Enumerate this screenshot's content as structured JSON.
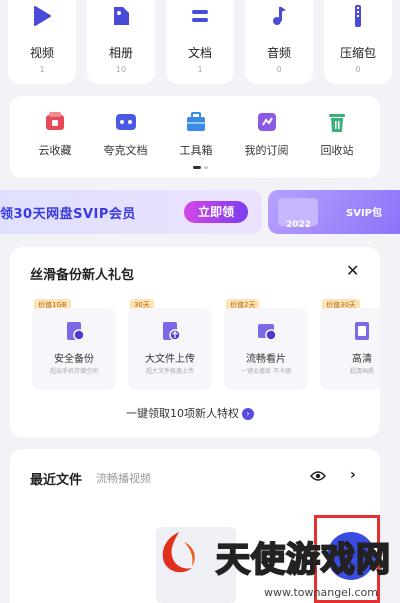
{
  "categories": [
    {
      "label": "视频",
      "count": "1",
      "icon": "play-icon"
    },
    {
      "label": "相册",
      "count": "10",
      "icon": "photo-icon"
    },
    {
      "label": "文档",
      "count": "1",
      "icon": "document-icon"
    },
    {
      "label": "音频",
      "count": "0",
      "icon": "music-icon"
    },
    {
      "label": "压缩包",
      "count": "0",
      "icon": "zip-icon"
    }
  ],
  "tools": [
    {
      "label": "云收藏",
      "icon": "cloud-bookmark-icon",
      "color": "#e64a5a"
    },
    {
      "label": "夸克文档",
      "icon": "quark-doc-icon",
      "color": "#4a5ae6"
    },
    {
      "label": "工具箱",
      "icon": "toolbox-icon",
      "color": "#3a8be6"
    },
    {
      "label": "我的订阅",
      "icon": "subscription-icon",
      "color": "#8a5ae6"
    },
    {
      "label": "回收站",
      "icon": "trash-icon",
      "color": "#3ab07a"
    }
  ],
  "banner": {
    "text": "领30天网盘SVIP会员",
    "button": "立即领",
    "year": "2022",
    "right_text": "SVIP包"
  },
  "gift": {
    "title": "丝滑备份新人礼包",
    "close": "✕",
    "perks": [
      {
        "tag": "价值1GB",
        "label": "安全备份",
        "sub": "超出手机存储空间",
        "icon": "safe-backup-icon"
      },
      {
        "tag": "30天",
        "label": "大文件上传",
        "sub": "超大文件极速上传",
        "icon": "large-upload-icon"
      },
      {
        "tag": "价值2天",
        "label": "流畅看片",
        "sub": "一键云播放 不卡顿",
        "icon": "smooth-video-icon"
      },
      {
        "tag": "价值30天",
        "label": "高清",
        "sub": "超清画质",
        "icon": "hd-icon"
      }
    ],
    "claim": "一键领取10项新人特权"
  },
  "recent": {
    "title": "最近文件",
    "subtitle": "流畅播视频",
    "chevron": "›"
  },
  "watermark": {
    "text": "天使游戏网",
    "url": "www.townangel.com"
  },
  "colors": {
    "accent": "#5a4be0",
    "background": "#f3f3f7",
    "fab": "#3a4ce0",
    "highlight": "#e53030"
  }
}
